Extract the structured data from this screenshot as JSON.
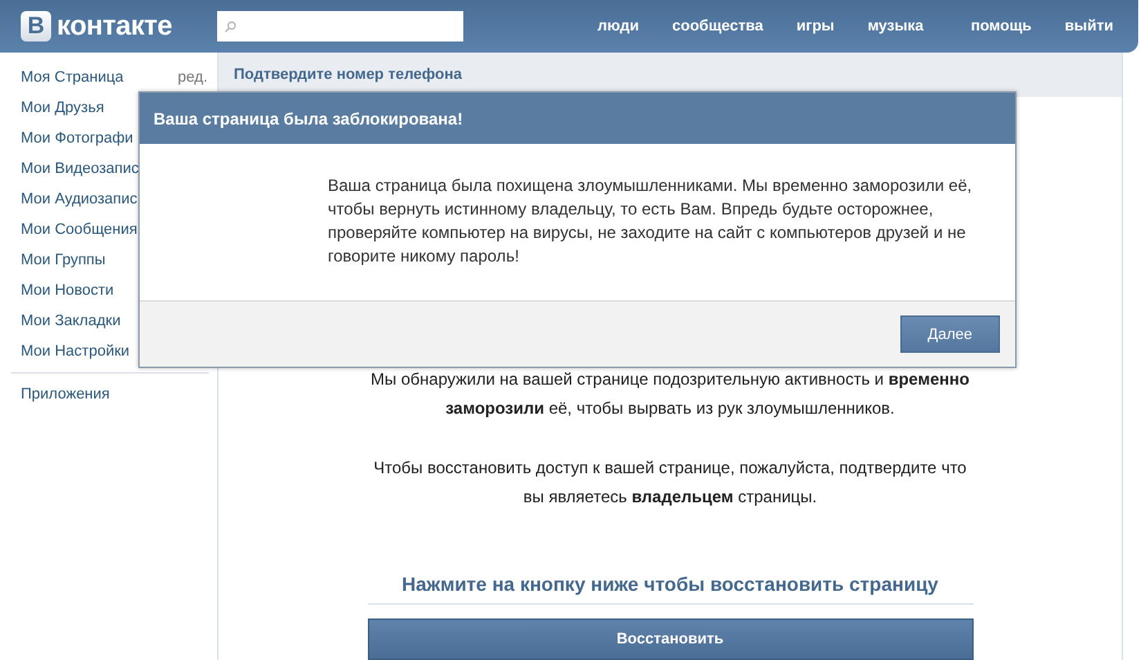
{
  "header": {
    "logo": {
      "badge": "В",
      "text": "контакте"
    },
    "nav_main": [
      "люди",
      "сообщества",
      "игры",
      "музыка"
    ],
    "nav_account": [
      "помощь",
      "выйти"
    ]
  },
  "sidebar": {
    "items": [
      {
        "label": "Моя Страница",
        "edit": "ред."
      },
      {
        "label": "Мои Друзья"
      },
      {
        "label": "Мои Фотографи"
      },
      {
        "label": "Мои Видеозапис"
      },
      {
        "label": "Мои Аудиозапис"
      },
      {
        "label": "Мои Сообщения"
      },
      {
        "label": "Мои Группы"
      },
      {
        "label": "Мои Новости"
      },
      {
        "label": "Мои Закладки"
      },
      {
        "label": "Мои Настройки"
      }
    ],
    "extra": [
      {
        "label": "Приложения"
      }
    ]
  },
  "content": {
    "title": "Подтвердите номер телефона",
    "paragraphs": [
      "Мы обнаружили на вашей странице подозрительную активность и **временно заморозили** её, чтобы вырвать из рук злоумышленников.",
      "Чтобы восстановить доступ к вашей странице, пожалуйста, подтвердите что вы являетесь **владельцем** страницы."
    ],
    "prompt": "Нажмите на кнопку ниже чтобы восстановить страницу",
    "button": "Восстановить"
  },
  "dialog": {
    "title": "Ваша страница была заблокирована!",
    "message": "Ваша страница была похищена злоумышленниками. Мы временно заморозили её, чтобы вернуть истинному владельцу, то есть Вам. Впредь будьте осторожнее, проверяйте компьютер на вирусы, не заходите на сайт с компьютеров друзей и не говорите никому пароль!",
    "button": "Далее"
  }
}
